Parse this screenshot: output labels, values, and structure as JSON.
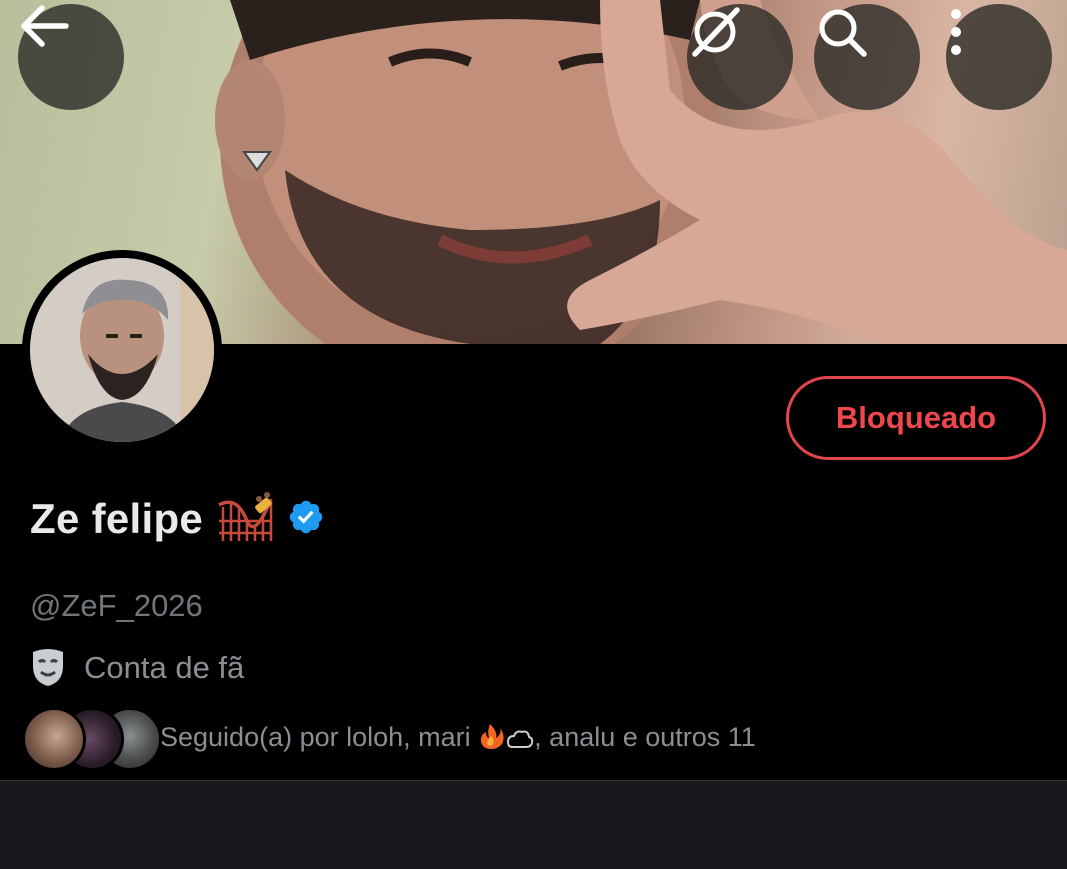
{
  "header": {
    "back_icon": "arrow-left-icon",
    "grok_icon": "grok-slash-circle-icon",
    "search_icon": "search-icon",
    "more_icon": "more-vertical-icon"
  },
  "profile": {
    "display_name": "Ze felipe",
    "name_emoji": "roller-coaster-emoji",
    "verified_badge": "verified-badge-icon",
    "handle": "@ZeF_2026",
    "label_icon": "performing-arts-mask-icon",
    "label": "Conta de fã",
    "followed_by_prefix": "Seguido(a) por loloh, mari ",
    "followed_by_emoji": "fire-cloud-emoji",
    "followed_by_suffix": ", analu e outros 11"
  },
  "actions": {
    "blocked_label": "Bloqueado"
  },
  "colors": {
    "blocked_red": "#f0474f",
    "verified_blue": "#1d9bf0",
    "muted_text": "#71767b",
    "background": "#000000"
  }
}
